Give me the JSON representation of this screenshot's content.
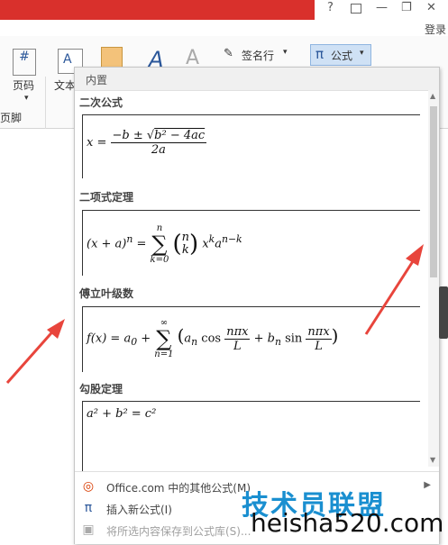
{
  "window": {
    "help": "?",
    "signin": "登录"
  },
  "ribbon": {
    "page_number": "页码",
    "text_box": "文本",
    "footer_fragment": "页脚",
    "signature_line": "签名行",
    "equation": "公式",
    "equation_symbol": "π"
  },
  "panel": {
    "header": "内置",
    "sections": [
      {
        "title": "二次公式"
      },
      {
        "title": "二项式定理"
      },
      {
        "title": "傅立叶级数"
      },
      {
        "title": "勾股定理"
      }
    ],
    "footer": [
      {
        "label": "Office.com 中的其他公式(M)"
      },
      {
        "label": "插入新公式(I)"
      },
      {
        "label": "将所选内容保存到公式库(S)..."
      }
    ]
  },
  "watermark": {
    "cn": "技术员联盟",
    "en": "heisha520.com"
  },
  "colors": {
    "titlebar": "#d9302c",
    "arrow": "#e8453c"
  }
}
